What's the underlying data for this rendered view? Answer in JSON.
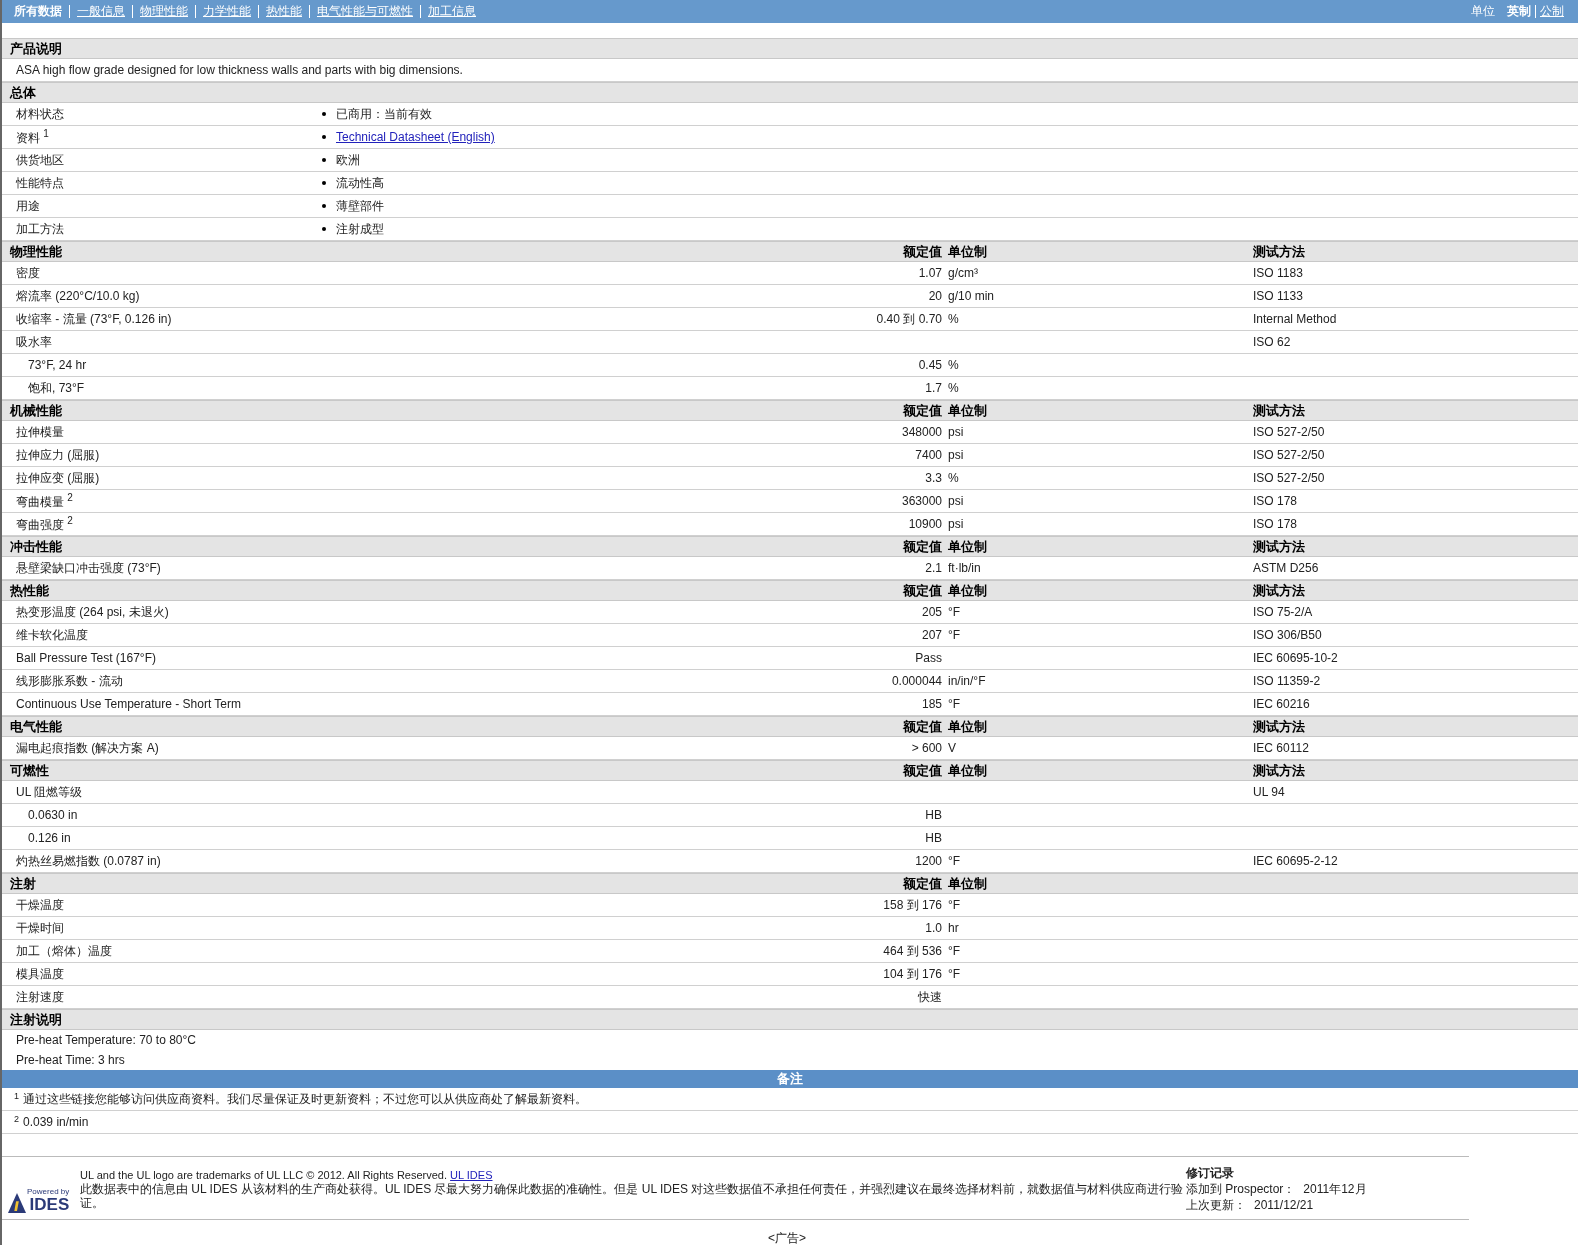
{
  "nav": {
    "links": [
      {
        "label": "所有数据",
        "selected": true
      },
      {
        "label": "一般信息",
        "selected": false
      },
      {
        "label": "物理性能",
        "selected": false
      },
      {
        "label": "力学性能",
        "selected": false
      },
      {
        "label": "热性能",
        "selected": false
      },
      {
        "label": "电气性能与可燃性",
        "selected": false
      },
      {
        "label": "加工信息",
        "selected": false
      }
    ],
    "units_label": "单位",
    "units": [
      {
        "label": "英制",
        "selected": true
      },
      {
        "label": "公制",
        "selected": false
      }
    ]
  },
  "description": {
    "title": "产品说明",
    "text": "ASA high flow grade designed for low thickness walls and parts with big dimensions."
  },
  "general": {
    "title": "总体",
    "rows": [
      {
        "label": "材料状态",
        "kind": "text",
        "value": "已商用：当前有效"
      },
      {
        "label": "资料 $^{1}$",
        "kind": "link",
        "value": "Technical Datasheet (English)"
      },
      {
        "label": "供货地区",
        "kind": "text",
        "value": "欧洲"
      },
      {
        "label": "性能特点",
        "kind": "text",
        "value": "流动性高"
      },
      {
        "label": "用途",
        "kind": "text",
        "value": "薄壁部件"
      },
      {
        "label": "加工方法",
        "kind": "text",
        "value": "注射成型"
      }
    ]
  },
  "sections": [
    {
      "title": "物理性能",
      "columns": [
        "额定值",
        "单位制",
        "测试方法"
      ],
      "rows": [
        {
          "label": "密度",
          "value": "1.07",
          "unit": "g/cm³",
          "method": "ISO 1183"
        },
        {
          "label": "熔流率  (220°C/10.0 kg)",
          "value": "20",
          "unit": "g/10 min",
          "method": "ISO 1133"
        },
        {
          "label": "收缩率  - 流量  (73°F, 0.126 in)",
          "value": "0.40 到  0.70",
          "unit": "%",
          "method": "Internal Method"
        },
        {
          "label": "吸水率",
          "method": "ISO 62",
          "children": [
            {
              "label": "73°F, 24 hr",
              "value": "0.45",
              "unit": "%"
            },
            {
              "label": "饱和, 73°F",
              "value": "1.7",
              "unit": "%"
            }
          ]
        }
      ]
    },
    {
      "title": "机械性能",
      "columns": [
        "额定值",
        "单位制",
        "测试方法"
      ],
      "rows": [
        {
          "label": "拉伸模量",
          "value": "348000",
          "unit": "psi",
          "method": "ISO 527-2/50"
        },
        {
          "label": "拉伸应力  (屈服)",
          "value": "7400",
          "unit": "psi",
          "method": "ISO 527-2/50"
        },
        {
          "label": "拉伸应变  (屈服)",
          "value": "3.3",
          "unit": "%",
          "method": "ISO 527-2/50"
        },
        {
          "label": "弯曲模量 $^{2}$",
          "value": "363000",
          "unit": "psi",
          "method": "ISO 178"
        },
        {
          "label": "弯曲强度 $^{2}$",
          "value": "10900",
          "unit": "psi",
          "method": "ISO 178"
        }
      ]
    },
    {
      "title": "冲击性能",
      "columns": [
        "额定值",
        "单位制",
        "测试方法"
      ],
      "rows": [
        {
          "label": "悬壁梁缺口冲击强度  (73°F)",
          "value": "2.1",
          "unit": "ft·lb/in",
          "method": "ASTM D256"
        }
      ]
    },
    {
      "title": "热性能",
      "columns": [
        "额定值",
        "单位制",
        "测试方法"
      ],
      "rows": [
        {
          "label": "热变形温度  (264 psi, 未退火)",
          "value": "205",
          "unit": "°F",
          "method": "ISO 75-2/A"
        },
        {
          "label": "维卡软化温度",
          "value": "207",
          "unit": "°F",
          "method": "ISO 306/B50"
        },
        {
          "label": "Ball Pressure Test (167°F)",
          "value": "Pass",
          "method": "IEC 60695-10-2"
        },
        {
          "label": "线形膨胀系数  - 流动",
          "value": "0.000044",
          "unit": "in/in/°F",
          "method": "ISO 11359-2"
        },
        {
          "label": "Continuous Use Temperature - Short Term",
          "value": "185",
          "unit": "°F",
          "method": "IEC 60216"
        }
      ]
    },
    {
      "title": "电气性能",
      "columns": [
        "额定值",
        "单位制",
        "测试方法"
      ],
      "rows": [
        {
          "label": "漏电起痕指数  (解决方案  A)",
          "value": "> 600",
          "unit": "V",
          "method": "IEC 60112"
        }
      ]
    },
    {
      "title": "可燃性",
      "columns": [
        "额定值",
        "单位制",
        "测试方法"
      ],
      "rows": [
        {
          "label": "UL 阻燃等级",
          "method": "UL 94",
          "children": [
            {
              "label": "0.0630 in",
              "value": "HB"
            },
            {
              "label": "0.126 in",
              "value": "HB"
            }
          ]
        },
        {
          "label": "灼热丝易燃指数  (0.0787 in)",
          "value": "1200",
          "unit": "°F",
          "method": "IEC 60695-2-12"
        }
      ]
    },
    {
      "title": "注射",
      "columns": [
        "额定值",
        "单位制"
      ],
      "rows": [
        {
          "label": "干燥温度",
          "value": "158 到  176",
          "unit": "°F"
        },
        {
          "label": "干燥时间",
          "value": "1.0",
          "unit": "hr"
        },
        {
          "label": "加工（熔体）温度",
          "value": "464 到  536",
          "unit": "°F"
        },
        {
          "label": "模具温度",
          "value": "104 到  176",
          "unit": "°F"
        },
        {
          "label": "注射速度",
          "value": "快速"
        }
      ]
    }
  ],
  "injection_notes": {
    "title": "注射说明",
    "lines": [
      "Pre-heat Temperature: 70 to 80°C",
      "Pre-heat Time: 3 hrs"
    ]
  },
  "notes": {
    "title": "备注",
    "items": [
      {
        "mark": "1",
        "text": "通过这些链接您能够访问供应商资料。我们尽量保证及时更新资料；不过您可以从供应商处了解最新资料。"
      },
      {
        "mark": "2",
        "text": "0.039 in/min"
      }
    ]
  },
  "footer": {
    "logo_top": "Powered by",
    "logo_name": "IDES",
    "trademark": "UL and the UL logo are trademarks of UL LLC © 2012. All Rights Reserved.",
    "trademark_link": "UL IDES",
    "disclaimer": "此数据表中的信息由  UL IDES 从该材料的生产商处获得。UL IDES 尽最大努力确保此数据的准确性。但是  UL IDES 对这些数据值不承担任何责任，并强烈建议在最终选择材料前，就数据值与材料供应商进行验证。",
    "revision": {
      "title": "修订记录",
      "rows": [
        {
          "label": "添加到  Prospector：",
          "value": "2011年12月"
        },
        {
          "label": "上次更新：",
          "value": "2011/12/21"
        }
      ]
    },
    "ad": "<广告>"
  }
}
